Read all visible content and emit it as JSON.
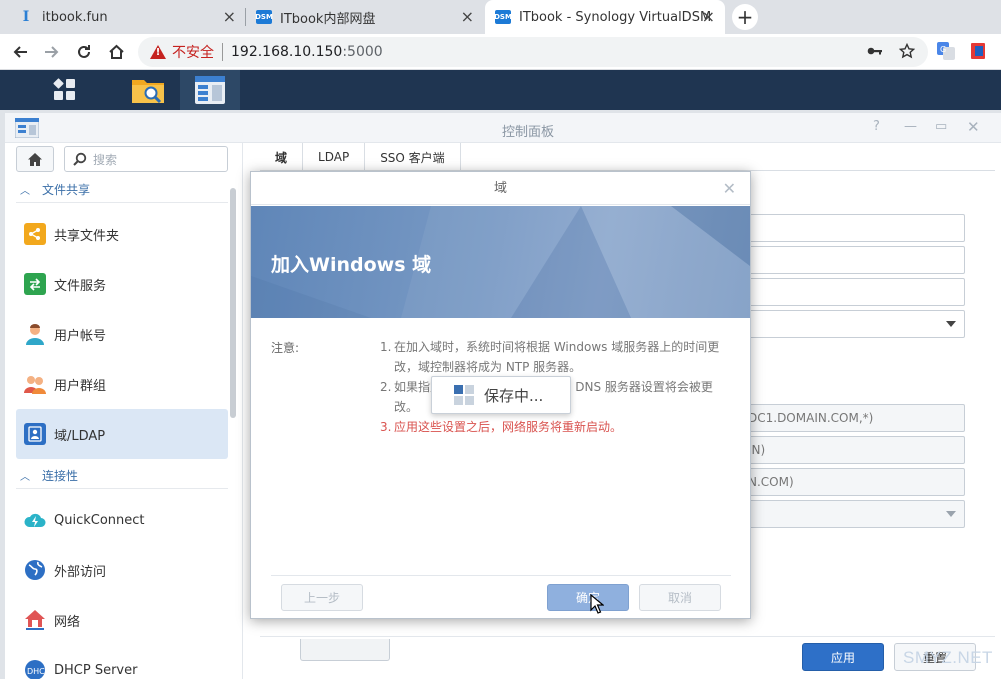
{
  "browser": {
    "tabs": [
      {
        "title": "itbook.fun",
        "favicon": "itbook-favicon"
      },
      {
        "title": "ITbook内部网盘",
        "favicon": "DSM"
      },
      {
        "title": "ITbook - Synology VirtualDSM",
        "favicon": "DSM"
      }
    ],
    "security_label": "不安全",
    "url_host": "192.168.10.150",
    "url_port": ":5000"
  },
  "window": {
    "title": "控制面板"
  },
  "sidebar": {
    "search_placeholder": "搜索",
    "sections": [
      {
        "label": "文件共享"
      },
      {
        "label": "连接性"
      }
    ],
    "items": [
      {
        "label": "共享文件夹",
        "icon": "shared-folder-icon"
      },
      {
        "label": "文件服务",
        "icon": "file-services-icon"
      },
      {
        "label": "用户帐号",
        "icon": "user-icon"
      },
      {
        "label": "用户群组",
        "icon": "group-icon"
      },
      {
        "label": "域/LDAP",
        "icon": "domain-ldap-icon",
        "active": true
      },
      {
        "label": "QuickConnect",
        "icon": "quickconnect-icon"
      },
      {
        "label": "外部访问",
        "icon": "external-access-icon"
      },
      {
        "label": "网络",
        "icon": "network-icon"
      },
      {
        "label": "DHCP Server",
        "icon": "dhcp-server-icon"
      }
    ]
  },
  "content": {
    "tabs": [
      "域",
      "LDAP",
      "SSO 客户端"
    ],
    "bg_fields": [
      "DC1.DOMAIN.COM,*)",
      "IN)",
      "N.COM)"
    ],
    "apply_label": "应用",
    "reset_label": "重置"
  },
  "modal": {
    "title": "域",
    "heading": "加入Windows 域",
    "note_label": "注意:",
    "notes": [
      {
        "num": "1.",
        "text": "在加入域时，系统时间将根据 Windows 域服务器上的时间更改，域控制器将成为 NTP 服务器。"
      },
      {
        "num": "2.",
        "text": "如果指定了 DNS 服务器，系统的 DNS 服务器设置将会被更改。"
      },
      {
        "num": "3.",
        "text": "应用这些设置之后，网络服务将重新启动。"
      }
    ],
    "saving_text": "保存中...",
    "prev_label": "上一步",
    "ok_label": "确定",
    "cancel_label": "取消"
  },
  "watermark": "SMYZ.NET",
  "colors": {
    "accent": "#2e70c8",
    "warning_red": "#d9534f",
    "taskbar": "#1f3551"
  }
}
